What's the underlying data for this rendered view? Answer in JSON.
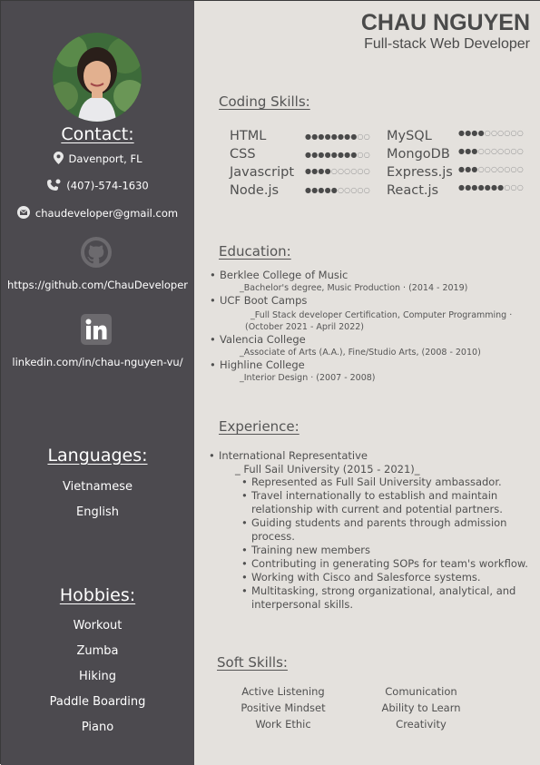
{
  "header": {
    "name": "CHAU NGUYEN",
    "title": "Full-stack Web Developer"
  },
  "sidebar": {
    "contact_heading": "Contact:",
    "location": "Davenport, FL",
    "phone": "(407)-574-1630",
    "email": "chaudeveloper@gmail.com",
    "github": "https://github.com/ChauDeveloper",
    "linkedin": "linkedin.com/in/chau-nguyen-vu/",
    "languages_heading": "Languages:",
    "languages": [
      "Vietnamese",
      "English"
    ],
    "hobbies_heading": "Hobbies:",
    "hobbies": [
      "Workout",
      "Zumba",
      "Hiking",
      "Paddle Boarding",
      "Piano"
    ]
  },
  "coding_skills": {
    "heading": "Coding Skills:",
    "skills": [
      {
        "name": "HTML",
        "level": 8,
        "max": 10
      },
      {
        "name": "MySQL",
        "level": 4,
        "max": 10
      },
      {
        "name": "CSS",
        "level": 8,
        "max": 10
      },
      {
        "name": "MongoDB",
        "level": 3,
        "max": 10
      },
      {
        "name": "Javascript",
        "level": 4,
        "max": 10
      },
      {
        "name": "Express.js",
        "level": 3,
        "max": 10
      },
      {
        "name": "Node.js",
        "level": 5,
        "max": 10
      },
      {
        "name": "React.js",
        "level": 7,
        "max": 10
      }
    ]
  },
  "education": {
    "heading": "Education:",
    "items": [
      {
        "school": "Berklee College of Music",
        "detail": "_Bachelor's degree, Music Production · (2014 - 2019)"
      },
      {
        "school": "UCF Boot Camps",
        "detail": "_Full Stack developer Certification, Computer Programming ·",
        "detail2": "(October 2021 - April 2022)"
      },
      {
        "school": "Valencia College",
        "detail": "_Associate of Arts (A.A.), Fine/Studio Arts, (2008 - 2010)"
      },
      {
        "school": "Highline College",
        "detail": "_Interior Design · (2007 - 2008)"
      }
    ]
  },
  "experience": {
    "heading": "Experience:",
    "role": "International Representative",
    "company": "_ Full Sail University (2015 - 2021)_",
    "bullets": [
      "Represented as Full Sail University ambassador.",
      "Travel internationally to establish and maintain relationship with current and potential partners.",
      "Guiding students and parents through admission process.",
      "Training new members",
      "Contributing in generating SOPs for team's workflow.",
      "Working with Cisco and Salesforce systems.",
      "Multitasking, strong organizational, analytical, and interpersonal skills."
    ]
  },
  "soft_skills": {
    "heading": "Soft Skills:",
    "items": [
      "Active Listening",
      "Comunication",
      "Positive Mindset",
      "Ability to Learn",
      "Work Ethic",
      "Creativity"
    ]
  },
  "colors": {
    "sidebar_bg": "#4c4a4f",
    "main_bg": "#e4e1dd",
    "text_dark": "#4a4a4a"
  }
}
